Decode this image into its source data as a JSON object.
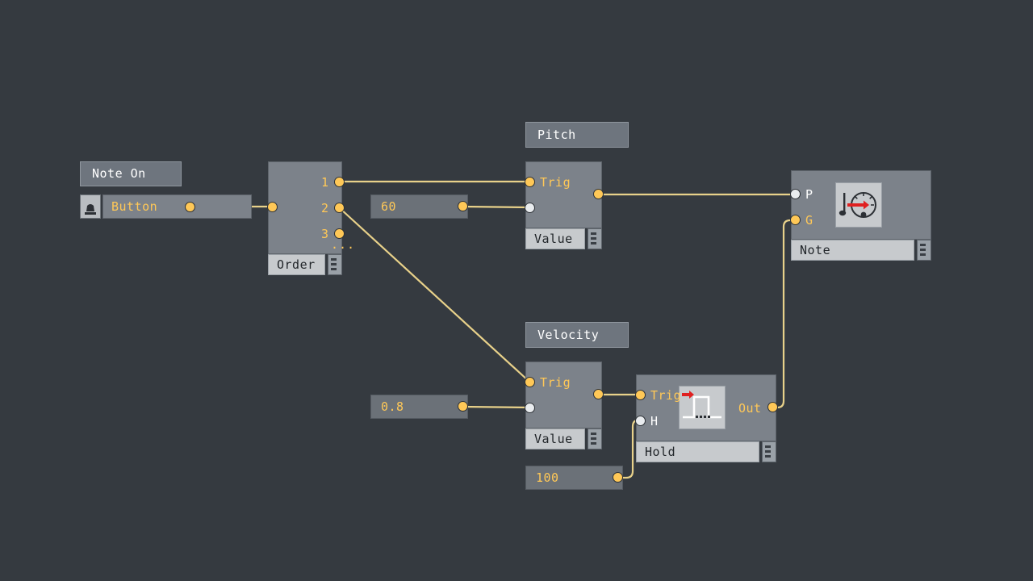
{
  "canvas": {
    "background": "#353a40",
    "wire_color": "#e8d18a",
    "port_yellow": "#ffc857",
    "port_white": "#e9ecef",
    "node_body": "#7c828a",
    "node_plate": "#c7cacd",
    "accent_red": "#e02020"
  },
  "comments": [
    {
      "id": "note-on",
      "text": "Note On"
    },
    {
      "id": "pitch",
      "text": "Pitch"
    },
    {
      "id": "velocity",
      "text": "Velocity"
    }
  ],
  "button_node": {
    "label": "Button",
    "icon": "push-button-icon"
  },
  "order_node": {
    "name": "Order",
    "outputs": [
      "1",
      "2",
      "3"
    ],
    "more": "...",
    "grip": "resize-grip"
  },
  "pitch_value_node": {
    "name": "Value",
    "inputs": [
      {
        "label": "Trig",
        "color": "yellow"
      },
      {
        "label": "",
        "color": "white"
      }
    ],
    "grip": "resize-grip"
  },
  "velocity_value_node": {
    "name": "Value",
    "inputs": [
      {
        "label": "Trig",
        "color": "yellow"
      },
      {
        "label": "",
        "color": "white"
      }
    ],
    "grip": "resize-grip"
  },
  "hold_node": {
    "name": "Hold",
    "inputs": [
      {
        "label": "Trig",
        "color": "yellow"
      },
      {
        "label": "H",
        "color": "white"
      }
    ],
    "output": {
      "label": "Out",
      "color": "yellow"
    },
    "icon": "gate-pulse-icon",
    "grip": "resize-grip"
  },
  "note_node": {
    "name": "Note",
    "inputs": [
      {
        "label": "P",
        "color": "white"
      },
      {
        "label": "G",
        "color": "yellow"
      }
    ],
    "icon": "midi-note-dial-icon",
    "grip": "resize-grip"
  },
  "numbers": [
    {
      "id": "pitch-number",
      "value": "60"
    },
    {
      "id": "velocity-number",
      "value": "0.8"
    },
    {
      "id": "hold-number",
      "value": "100"
    }
  ]
}
